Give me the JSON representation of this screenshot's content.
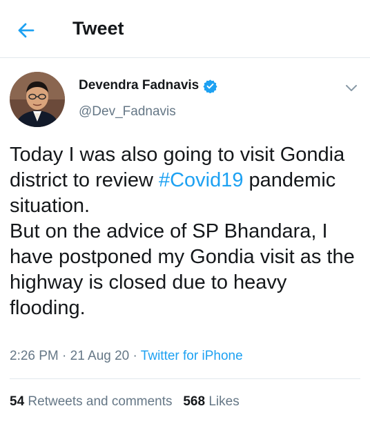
{
  "header": {
    "title": "Tweet",
    "back_icon": "arrow-left-icon"
  },
  "author": {
    "display_name": "Devendra Fadnavis",
    "handle": "@Dev_Fadnavis",
    "verified_icon": "verified-badge-icon",
    "verified_color": "#1da1f2"
  },
  "tweet": {
    "text_part1": "Today I was also going to visit Gondia district to review ",
    "hashtag": "#Covid19",
    "text_part2": " pandemic situation.",
    "text_part3": "But on the advice of SP Bhandara, I have postponed my Gondia visit as the highway is closed due to heavy flooding."
  },
  "meta": {
    "time": "2:26 PM",
    "separator": "·",
    "date": "21 Aug 20",
    "source": "Twitter for iPhone"
  },
  "stats": {
    "retweets_count": "54",
    "retweets_label": "Retweets and comments",
    "likes_count": "568",
    "likes_label": "Likes"
  },
  "colors": {
    "link": "#1da1f2",
    "secondary": "#657786",
    "text": "#14171a",
    "divider": "#e1e8ed"
  }
}
